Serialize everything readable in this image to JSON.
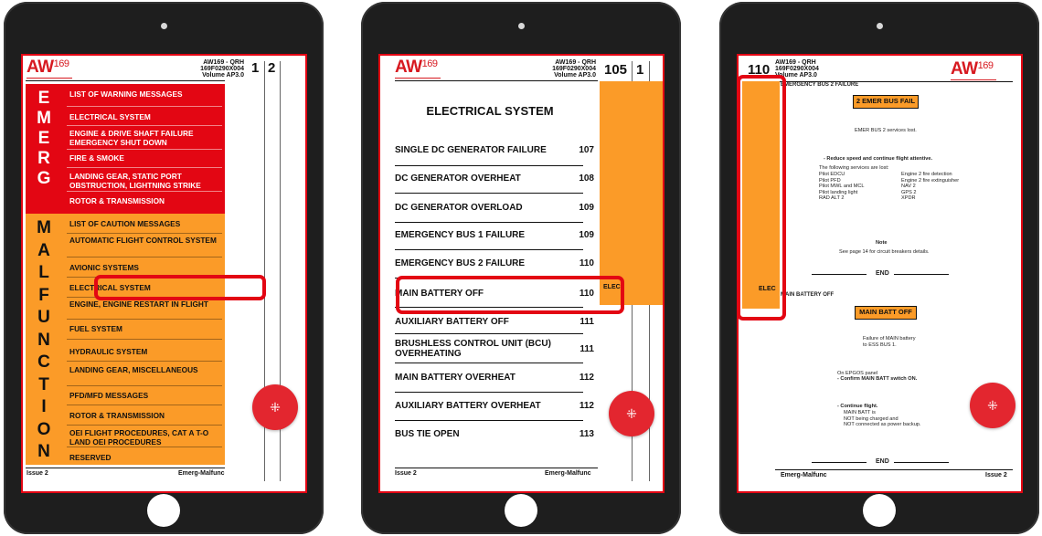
{
  "header": {
    "logo_text": "AW",
    "logo_sup": "169",
    "doc_line1": "AW169 - QRH",
    "doc_line2": "169F0290X004",
    "doc_line3": "Volume AP3.0"
  },
  "tablet1": {
    "page_num": "1",
    "page_num_next": "2",
    "emerg_letters": [
      "E",
      "M",
      "E",
      "R",
      "G"
    ],
    "malf_letters": [
      "M",
      "A",
      "L",
      "F",
      "U",
      "N",
      "C",
      "T",
      "I",
      "O",
      "N"
    ],
    "emerg_items": [
      "LIST OF WARNING MESSAGES",
      "ELECTRICAL SYSTEM",
      "ENGINE & DRIVE SHAFT FAILURE EMERGENCY SHUT DOWN",
      "FIRE & SMOKE",
      "LANDING GEAR, STATIC PORT OBSTRUCTION, LIGHTNING STRIKE",
      "ROTOR & TRANSMISSION"
    ],
    "malf_items": [
      "LIST OF CAUTION MESSAGES",
      "AUTOMATIC FLIGHT CONTROL SYSTEM",
      "AVIONIC SYSTEMS",
      "ELECTRICAL SYSTEM",
      "ENGINE, ENGINE RESTART IN FLIGHT",
      "FUEL SYSTEM",
      "HYDRAULIC SYSTEM",
      "LANDING GEAR, MISCELLANEOUS",
      "PFD/MFD MESSAGES",
      "ROTOR & TRANSMISSION",
      "OEI FLIGHT PROCEDURES, CAT A T-O LAND OEI PROCEDURES",
      "RESERVED"
    ],
    "footer_left": "Issue  2",
    "footer_right": "Emerg-Malfunc"
  },
  "tablet2": {
    "page_num": "105",
    "page_num_next": "1",
    "title": "ELECTRICAL SYSTEM",
    "side_tab": "ELEC",
    "rows": [
      {
        "label": "SINGLE DC GENERATOR FAILURE",
        "page": "107"
      },
      {
        "label": "DC GENERATOR OVERHEAT",
        "page": "108"
      },
      {
        "label": "DC GENERATOR OVERLOAD",
        "page": "109"
      },
      {
        "label": "EMERGENCY BUS 1 FAILURE",
        "page": "109"
      },
      {
        "label": "EMERGENCY BUS 2 FAILURE",
        "page": "110"
      },
      {
        "label": "MAIN BATTERY OFF",
        "page": "110"
      },
      {
        "label": "AUXILIARY BATTERY OFF",
        "page": "111"
      },
      {
        "label": "BRUSHLESS CONTROL UNIT (BCU) OVERHEATING",
        "page": "111"
      },
      {
        "label": "MAIN BATTERY OVERHEAT",
        "page": "112"
      },
      {
        "label": "AUXILIARY BATTERY OVERHEAT",
        "page": "112"
      },
      {
        "label": "BUS TIE OPEN",
        "page": "113"
      }
    ],
    "footer_left": "Issue 2",
    "footer_right": "Emerg-Malfunc"
  },
  "tablet3": {
    "page_num": "110",
    "side_tab": "ELEC",
    "section1_heading": "EMERGENCY BUS 2 FAILURE",
    "annunciator1": "2 EMER BUS FAIL",
    "services_lost": "EMER BUS 2 services lost.",
    "reduce_speed": "- Reduce speed and continue flight attentive.",
    "following": "The following services are lost:",
    "services_left": [
      "Pilot EDCU",
      "Pilot PFD",
      "Pilot MWL and MCL",
      "Pilot landing light",
      "RAD ALT 2"
    ],
    "services_right": [
      "Engine 2 fire detection",
      "Engine 2 fire extinguisher",
      "NAV 2",
      "GPS 2",
      "XPDR"
    ],
    "note_title": "Note",
    "note_text": "See page  14 for circuit breakers details.",
    "end_label": "END",
    "section2_heading": "MAIN BATTERY OFF",
    "annunciator2": "MAIN BATT OFF",
    "failure_text1": "Failure of MAIN battery",
    "failure_text2": "to ESS BUS 1.",
    "on_panel": "On EPGOS panel",
    "confirm": "- Confirm MAIN BATT switch ON.",
    "continue": "- Continue flight.",
    "batt_line1": "MAIN BATT is",
    "batt_line2": "NOT being charged and",
    "batt_line3": "NOT connected as power backup.",
    "footer_left": "Emerg-Malfunc",
    "footer_right": "Issue 2"
  },
  "fab_icon": "collapse-arrows-icon",
  "colors": {
    "red": "#e30613",
    "orange": "#fb9b28",
    "bezel": "#1e1e1e"
  }
}
